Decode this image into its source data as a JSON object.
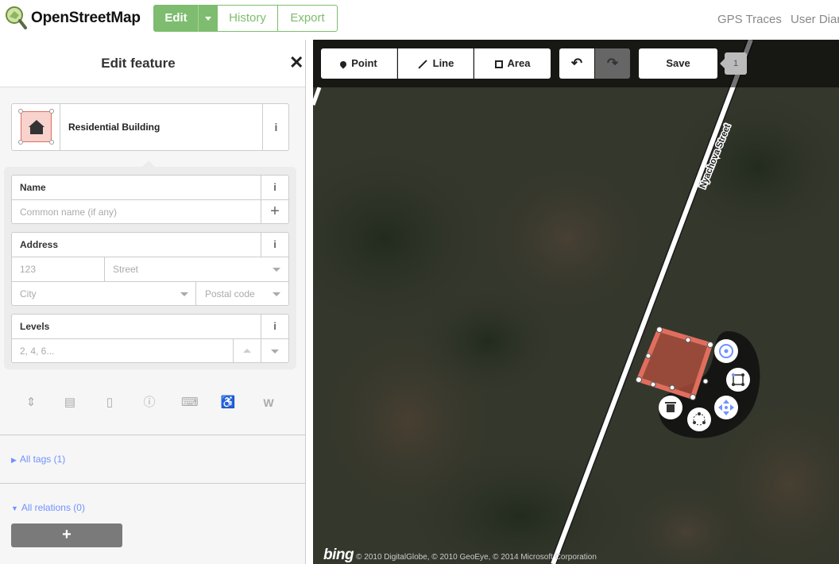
{
  "brand": {
    "name": "OpenStreetMap"
  },
  "nav": {
    "edit_label": "Edit",
    "history_label": "History",
    "export_label": "Export",
    "gps_traces_label": "GPS Traces",
    "user_diaries_label": "User Diar",
    "accent_color": "#7ebc6f"
  },
  "sidebar": {
    "title": "Edit feature",
    "close_glyph": "✕",
    "preset": {
      "name": "Residential Building",
      "info_glyph": "i",
      "icon": "building-icon"
    },
    "fields": {
      "name": {
        "label": "Name",
        "placeholder": "Common name (if any)",
        "add_glyph": "+"
      },
      "address": {
        "label": "Address",
        "housenumber_placeholder": "123",
        "street_placeholder": "Street",
        "city_placeholder": "City",
        "postcode_placeholder": "Postal code"
      },
      "levels": {
        "label": "Levels",
        "placeholder": "2, 4, 6..."
      }
    },
    "more_field_icons": [
      "elevator-icon",
      "note-icon",
      "phone-icon",
      "info-circle-icon",
      "laptop-icon",
      "wheelchair-icon",
      "wikipedia-icon"
    ],
    "all_tags_label": "All tags (1)",
    "all_relations_label": "All relations (0)",
    "add_relation_glyph": "+"
  },
  "map": {
    "toolbar": {
      "point_label": "Point",
      "line_label": "Line",
      "area_label": "Area",
      "save_label": "Save",
      "edit_count": "1"
    },
    "street_label": "Nyachova Street",
    "attribution": {
      "bing": "bing",
      "text": "© 2010 DigitalGlobe, © 2010 GeoEye, © 2014 Microsoft Corporation"
    },
    "selection_color": "#e06e5f",
    "radial_menu_icons": [
      "circularize-icon",
      "orthogonalize-icon",
      "move-icon",
      "reflect-icon",
      "delete-icon"
    ]
  }
}
